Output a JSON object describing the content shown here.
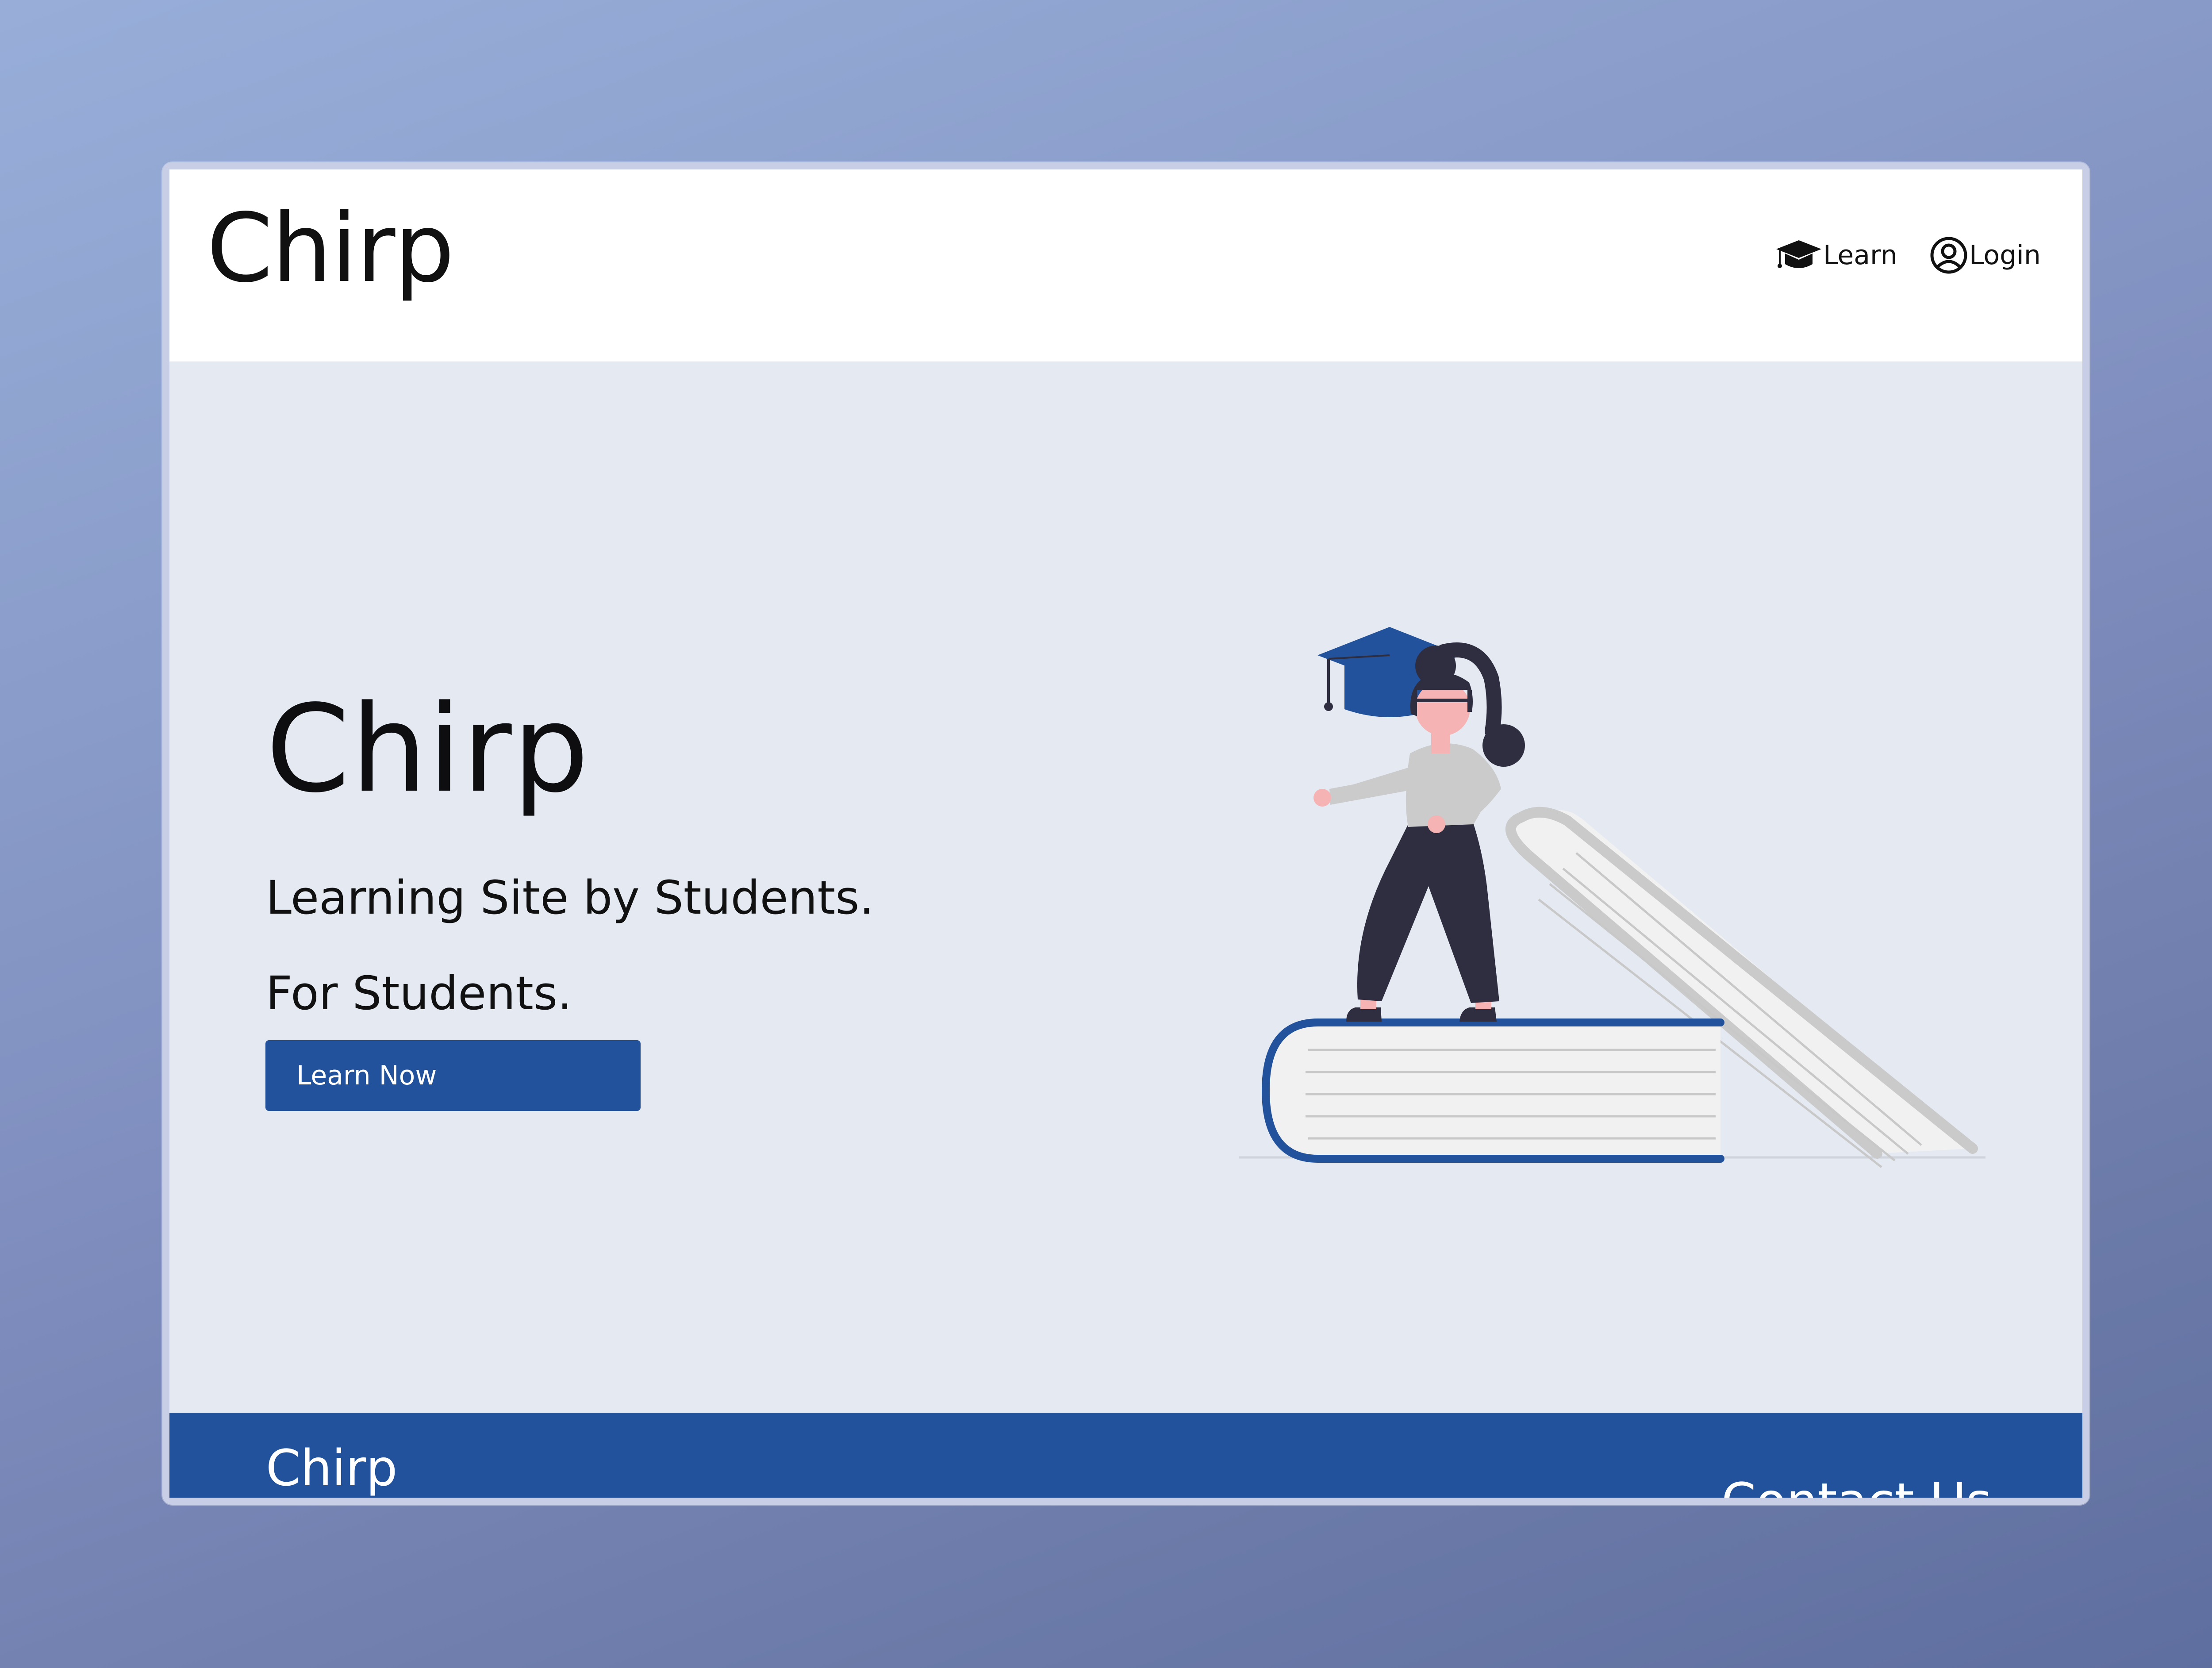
{
  "nav": {
    "brand": "Chirp",
    "learn_label": "Learn",
    "login_label": "Login",
    "learn_icon": "graduation-cap-icon",
    "login_icon": "user-circle-icon"
  },
  "hero": {
    "title": "Chirp",
    "tagline_1": "Learning Site by Students.",
    "tagline_2": "For Students.",
    "cta_label": "Learn Now"
  },
  "footer": {
    "brand": "Chirp",
    "contact_label": "Contact Us"
  },
  "colors": {
    "primary": "#21529b",
    "hero_background": "#e5e9f2",
    "nav_background": "#ffffff",
    "text": "#111111"
  }
}
